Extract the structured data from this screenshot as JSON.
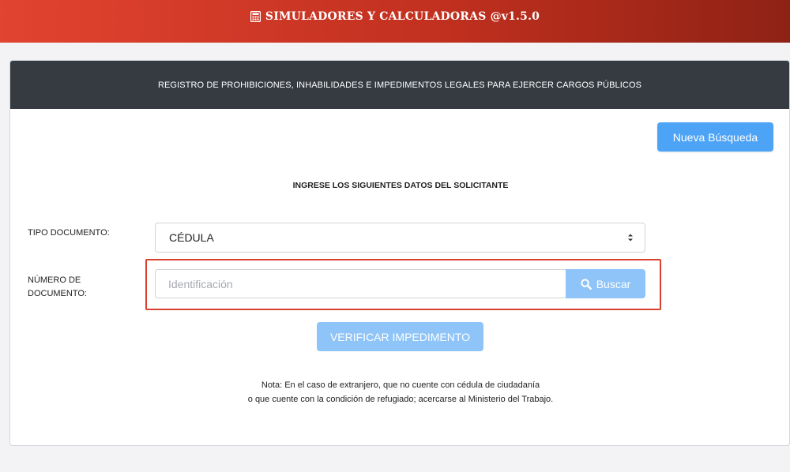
{
  "app": {
    "title": "SIMULADORES Y CALCULADORAS @v1.5.0",
    "icon": "calculator-icon",
    "brand_color": "#c2301f"
  },
  "card": {
    "header_title": "REGISTRO DE PROHIBICIONES, INHABILIDADES E IMPEDIMENTOS LEGALES PARA EJERCER CARGOS PÚBLICOS",
    "new_search_label": "Nueva Búsqueda",
    "subtitle": "INGRESE LOS SIGUIENTES DATOS DEL SOLICITANTE"
  },
  "form": {
    "doc_type_label": "TIPO DOCUMENTO:",
    "doc_type_value": "CÉDULA",
    "doc_number_label_line1": "NÚMERO DE",
    "doc_number_label_line2": "DOCUMENTO:",
    "doc_number_value": "",
    "doc_number_placeholder": "Identificación",
    "search_label": "Buscar",
    "verify_label": "VERIFICAR IMPEDIMENTO"
  },
  "note": {
    "line1": "Nota: En el caso de extranjero, que no cuente con cédula de ciudadanía",
    "line2": "o que cuente con la condición de refugiado; acercarse al Ministerio del Trabajo."
  },
  "colors": {
    "header_dark": "#353b41",
    "primary_button": "#4da3f5",
    "disabled_button": "#8ec4f8",
    "highlight_border": "#d8412f"
  }
}
